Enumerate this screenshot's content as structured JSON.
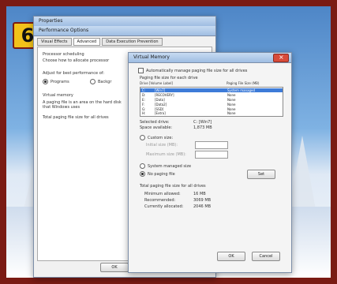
{
  "badge": "6",
  "back_window": {
    "title": "Properties",
    "sub_title": "Performance Options",
    "tabs": [
      "Visual Effects",
      "Advanced",
      "Data Execution Prevention"
    ],
    "processor_scheduling": "Processor scheduling",
    "choose_how": "Choose how to allocate processor",
    "adjust_best": "Adjust for best performance of:",
    "programs": "Programs",
    "background": "Backgr",
    "virtual_memory": "Virtual memory",
    "paging_desc": "A paging file is an area on the hard disk that Windows uses",
    "total_paging": "Total paging file size for all drives",
    "ok": "OK"
  },
  "vm_dialog": {
    "title": "Virtual Memory",
    "auto_manage": "Automatically manage paging file size for all drives",
    "paging_each": "Paging file size for each drive",
    "col_drive": "Drive  [Volume Label]",
    "col_size": "Paging File Size (MB)",
    "drives": [
      {
        "drive": "C:",
        "label": "[Win7]",
        "size": "System managed",
        "selected": true
      },
      {
        "drive": "D:",
        "label": "[RECOVERY]",
        "size": "None",
        "selected": false
      },
      {
        "drive": "E:",
        "label": "[Data]",
        "size": "None",
        "selected": false
      },
      {
        "drive": "F:",
        "label": "[Data2]",
        "size": "None",
        "selected": false
      },
      {
        "drive": "G:",
        "label": "[SSD]",
        "size": "None",
        "selected": false
      },
      {
        "drive": "H:",
        "label": "[Extra]",
        "size": "None",
        "selected": false
      }
    ],
    "selected_drive_label": "Selected drive:",
    "selected_drive_value": "C:  [Win7]",
    "space_available_label": "Space available:",
    "space_available_value": "1,873 MB",
    "custom_size": "Custom size:",
    "initial_size": "Initial size (MB):",
    "maximum_size": "Maximum size (MB):",
    "system_managed": "System managed size",
    "no_paging": "No paging file",
    "set": "Set",
    "total_title": "Total paging file size for all drives",
    "min_allowed_label": "Minimum allowed:",
    "min_allowed_value": "16 MB",
    "recommended_label": "Recommended:",
    "recommended_value": "3069 MB",
    "currently_label": "Currently allocated:",
    "currently_value": "2046 MB",
    "ok": "OK",
    "cancel": "Cancel"
  }
}
